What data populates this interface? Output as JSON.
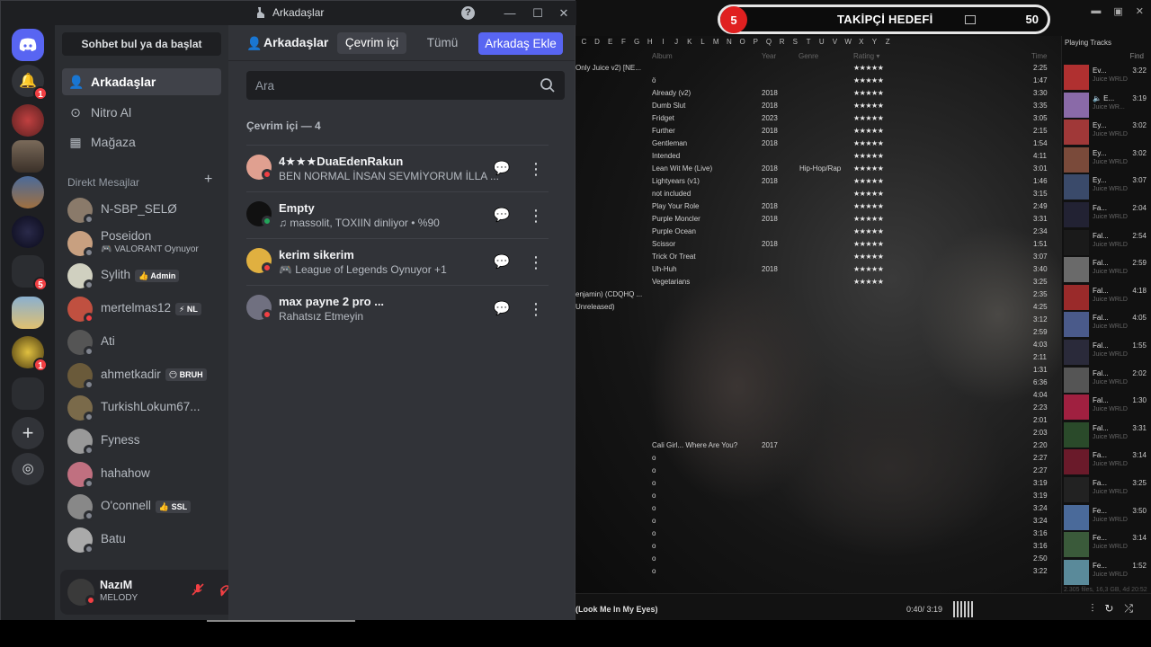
{
  "player": {
    "goal": {
      "current": "5",
      "title": "TAKİPÇİ HEDEFİ",
      "target": "50"
    },
    "alphabet": [
      "C",
      "D",
      "E",
      "F",
      "G",
      "H",
      "I",
      "J",
      "K",
      "L",
      "M",
      "N",
      "O",
      "P",
      "Q",
      "R",
      "S",
      "T",
      "U",
      "V",
      "W",
      "X",
      "Y",
      "Z"
    ],
    "columns": {
      "album": "Album",
      "year": "Year",
      "genre": "Genre",
      "rating": "Rating ▾",
      "time": "Time"
    },
    "tracks": [
      {
        "left": "Only Juice v2) [NE...",
        "title": "",
        "year": "",
        "genre": "",
        "stars": "★★★★★",
        "time": "2:25"
      },
      {
        "left": "",
        "title": "ö",
        "year": "",
        "genre": "",
        "stars": "★★★★★",
        "time": "1:47"
      },
      {
        "left": "",
        "title": "Already (v2)",
        "year": "2018",
        "genre": "",
        "stars": "★★★★★",
        "time": "3:30"
      },
      {
        "left": "",
        "title": "Dumb Slut",
        "year": "2018",
        "genre": "",
        "stars": "★★★★★",
        "time": "3:35"
      },
      {
        "left": "",
        "title": "Fridget",
        "year": "2023",
        "genre": "",
        "stars": "★★★★★",
        "time": "3:05"
      },
      {
        "left": "",
        "title": "Further",
        "year": "2018",
        "genre": "",
        "stars": "★★★★★",
        "time": "2:15"
      },
      {
        "left": "",
        "title": "Gentleman",
        "year": "2018",
        "genre": "",
        "stars": "★★★★★",
        "time": "1:54"
      },
      {
        "left": "",
        "title": "Intended",
        "year": "",
        "genre": "",
        "stars": "★★★★★",
        "time": "4:11"
      },
      {
        "left": "",
        "title": "Lean Wit Me (Live)",
        "year": "2018",
        "genre": "Hip-Hop/Rap",
        "stars": "★★★★★",
        "time": "3:01"
      },
      {
        "left": "",
        "title": "Lightyears (v1)",
        "year": "2018",
        "genre": "",
        "stars": "★★★★★",
        "time": "1:46"
      },
      {
        "left": "",
        "title": "not included",
        "year": "",
        "genre": "",
        "stars": "★★★★★",
        "time": "3:15"
      },
      {
        "left": "",
        "title": "Play Your Role",
        "year": "2018",
        "genre": "",
        "stars": "★★★★★",
        "time": "2:49"
      },
      {
        "left": "",
        "title": "Purple Moncler",
        "year": "2018",
        "genre": "",
        "stars": "★★★★★",
        "time": "3:31"
      },
      {
        "left": "",
        "title": "Purple Ocean",
        "year": "",
        "genre": "",
        "stars": "★★★★★",
        "time": "2:34"
      },
      {
        "left": "",
        "title": "Scissor",
        "year": "2018",
        "genre": "",
        "stars": "★★★★★",
        "time": "1:51"
      },
      {
        "left": "",
        "title": "Trick Or Treat",
        "year": "",
        "genre": "",
        "stars": "★★★★★",
        "time": "3:07"
      },
      {
        "left": "",
        "title": "Uh-Huh",
        "year": "2018",
        "genre": "",
        "stars": "★★★★★",
        "time": "3:40"
      },
      {
        "left": "",
        "title": "Vegetarians",
        "year": "",
        "genre": "",
        "stars": "★★★★★",
        "time": "3:25"
      },
      {
        "left": "enjamin) (CDQHQ ...",
        "title": "",
        "year": "",
        "genre": "",
        "stars": "",
        "time": "2:35"
      },
      {
        "left": "Unreleased)",
        "title": "",
        "year": "",
        "genre": "",
        "stars": "",
        "time": "4:25"
      },
      {
        "left": "",
        "title": "",
        "year": "",
        "genre": "",
        "stars": "",
        "time": "3:12"
      },
      {
        "left": "",
        "title": "",
        "year": "",
        "genre": "",
        "stars": "",
        "time": "2:59"
      },
      {
        "left": "",
        "title": "",
        "year": "",
        "genre": "",
        "stars": "",
        "time": "4:03"
      },
      {
        "left": "",
        "title": "",
        "year": "",
        "genre": "",
        "stars": "",
        "time": "2:11"
      },
      {
        "left": "",
        "title": "",
        "year": "",
        "genre": "",
        "stars": "",
        "time": "1:31"
      },
      {
        "left": "",
        "title": "",
        "year": "",
        "genre": "",
        "stars": "",
        "time": "6:36"
      },
      {
        "left": "",
        "title": "",
        "year": "",
        "genre": "",
        "stars": "",
        "time": "4:04"
      },
      {
        "left": "",
        "title": "",
        "year": "",
        "genre": "",
        "stars": "",
        "time": "2:23"
      },
      {
        "left": "",
        "title": "",
        "year": "",
        "genre": "",
        "stars": "",
        "time": "2:01"
      },
      {
        "left": "",
        "title": "",
        "year": "",
        "genre": "",
        "stars": "",
        "time": "2:03"
      },
      {
        "left": "",
        "title": "Cali Girl... Where Are You?",
        "year": "2017",
        "genre": "",
        "stars": "",
        "time": "2:20"
      },
      {
        "left": "",
        "title": "o",
        "year": "",
        "genre": "",
        "stars": "",
        "time": "2:27"
      },
      {
        "left": "",
        "title": "o",
        "year": "",
        "genre": "",
        "stars": "",
        "time": "2:27"
      },
      {
        "left": "",
        "title": "o",
        "year": "",
        "genre": "",
        "stars": "",
        "time": "3:19"
      },
      {
        "left": "",
        "title": "o",
        "year": "",
        "genre": "",
        "stars": "",
        "time": "3:19"
      },
      {
        "left": "",
        "title": "o",
        "year": "",
        "genre": "",
        "stars": "",
        "time": "3:24"
      },
      {
        "left": "",
        "title": "o",
        "year": "",
        "genre": "",
        "stars": "",
        "time": "3:24"
      },
      {
        "left": "",
        "title": "o",
        "year": "",
        "genre": "",
        "stars": "",
        "time": "3:16"
      },
      {
        "left": "",
        "title": "o",
        "year": "",
        "genre": "",
        "stars": "",
        "time": "3:16"
      },
      {
        "left": "",
        "title": "o",
        "year": "",
        "genre": "",
        "stars": "",
        "time": "2:50"
      },
      {
        "left": "",
        "title": "o",
        "year": "",
        "genre": "",
        "stars": "",
        "time": "3:22"
      }
    ],
    "playing_title": "Playing Tracks",
    "find": "Find",
    "playing": [
      {
        "name": "Ev...",
        "artist": "Juice WRLD",
        "dur": "3:22",
        "color": "#b03030"
      },
      {
        "name": "🔈 E...",
        "artist": "Juice WR...",
        "dur": "3:19",
        "color": "#8a6aa8"
      },
      {
        "name": "Ey...",
        "artist": "Juice WRLD",
        "dur": "3:02",
        "color": "#a03838"
      },
      {
        "name": "Ey...",
        "artist": "Juice WRLD",
        "dur": "3:02",
        "color": "#7a4a3a"
      },
      {
        "name": "Ey...",
        "artist": "Juice WRLD",
        "dur": "3:07",
        "color": "#3a4a6a"
      },
      {
        "name": "Fa...",
        "artist": "Juice WRLD",
        "dur": "2:04",
        "color": "#222233"
      },
      {
        "name": "Fal...",
        "artist": "Juice WRLD",
        "dur": "2:54",
        "color": "#1a1a1a"
      },
      {
        "name": "Fal...",
        "artist": "Juice WRLD",
        "dur": "2:59",
        "color": "#6a6a6a"
      },
      {
        "name": "Fal...",
        "artist": "Juice WRLD",
        "dur": "4:18",
        "color": "#9a2a2a"
      },
      {
        "name": "Fal...",
        "artist": "Juice WRLD",
        "dur": "4:05",
        "color": "#4a5a8a"
      },
      {
        "name": "Fal...",
        "artist": "Juice WRLD",
        "dur": "1:55",
        "color": "#2a2a3a"
      },
      {
        "name": "Fal...",
        "artist": "Juice WRLD",
        "dur": "2:02",
        "color": "#555"
      },
      {
        "name": "Fal...",
        "artist": "Juice WRLD",
        "dur": "1:30",
        "color": "#a02040"
      },
      {
        "name": "Fal...",
        "artist": "Juice WRLD",
        "dur": "3:31",
        "color": "#2a4a2a"
      },
      {
        "name": "Fa...",
        "artist": "Juice WRLD",
        "dur": "3:14",
        "color": "#6a1a2a"
      },
      {
        "name": "Fa...",
        "artist": "Juice WRLD",
        "dur": "3:25",
        "color": "#222"
      },
      {
        "name": "Fe...",
        "artist": "Juice WRLD",
        "dur": "3:50",
        "color": "#4a6a9a"
      },
      {
        "name": "Fe...",
        "artist": "Juice WRLD",
        "dur": "3:14",
        "color": "#3a5a3a"
      },
      {
        "name": "Fe...",
        "artist": "Juice WRLD",
        "dur": "1:52",
        "color": "#5a8a9a"
      }
    ],
    "disk_info": "2.305 files, 16,3 GB, 4d 20:52",
    "now_playing": "(Look Me In My Eyes)",
    "np_time": "0:40/ 3:19"
  },
  "discord": {
    "window_title": "Arkadaşlar",
    "guild_badges": {
      "notif": "1",
      "g6": "5",
      "g8": "1"
    },
    "sidebar": {
      "search": "Sohbet bul ya da başlat",
      "nav": [
        {
          "label": "Arkadaşlar",
          "icon": "friends-icon"
        },
        {
          "label": "Nitro Al",
          "icon": "nitro-icon"
        },
        {
          "label": "Mağaza",
          "icon": "shop-icon"
        }
      ],
      "dm_header": "Direkt Mesajlar",
      "dms": [
        {
          "name": "N-SBP_SELØ",
          "activity": "",
          "badge": "",
          "status": "offline",
          "color": "#8a7a6a"
        },
        {
          "name": "Poseidon",
          "activity": "🎮 VALORANT Oynuyor",
          "badge": "",
          "status": "offline",
          "color": "#c8a080"
        },
        {
          "name": "Sylith",
          "activity": "",
          "badge": "👍 Admin",
          "status": "offline",
          "color": "#d0d0c0"
        },
        {
          "name": "mertelmas12",
          "activity": "",
          "badge": "⚡ NL",
          "status": "dnd",
          "color": "#c05040"
        },
        {
          "name": "Ati",
          "activity": "",
          "badge": "",
          "status": "offline",
          "color": "#555"
        },
        {
          "name": "ahmetkadir",
          "activity": "",
          "badge": "😶 BRUH",
          "status": "offline",
          "color": "#6a5a3a"
        },
        {
          "name": "TurkishLokum67...",
          "activity": "",
          "badge": "",
          "status": "offline",
          "color": "#7a6a4a"
        },
        {
          "name": "Fyness",
          "activity": "",
          "badge": "",
          "status": "offline",
          "color": "#999"
        },
        {
          "name": "hahahow",
          "activity": "",
          "badge": "",
          "status": "offline",
          "color": "#c07080"
        },
        {
          "name": "O'connell",
          "activity": "",
          "badge": "👍 SSL",
          "status": "offline",
          "color": "#888"
        },
        {
          "name": "Batu",
          "activity": "",
          "badge": "",
          "status": "offline",
          "color": "#aaa"
        }
      ]
    },
    "user": {
      "name": "NazıM",
      "status": "MELODY"
    },
    "header": {
      "title": "Arkadaşlar",
      "tabs": [
        "Çevrim içi",
        "Tümü"
      ],
      "add_friend": "Arkadaş Ekle"
    },
    "search_placeholder": "Ara",
    "online_header": "Çevrim içi — 4",
    "friends": [
      {
        "name": "4★★★DuaEdenRakun",
        "status": "BEN NORMAL İNSAN SEVMİYORUM İLLA ...",
        "dot": "dnd",
        "color": "#e0a090"
      },
      {
        "name": "Empty",
        "status": "♫ massolit, TOXIIN dinliyor • %90",
        "dot": "online",
        "color": "#111"
      },
      {
        "name": "kerim sikerim",
        "status": "🎮 League of Legends Oynuyor +1",
        "dot": "dnd",
        "color": "#e0b040"
      },
      {
        "name": "max payne 2 pro ...",
        "status": "Rahatsız Etmeyin",
        "dot": "dnd",
        "color": "#707080"
      }
    ]
  }
}
